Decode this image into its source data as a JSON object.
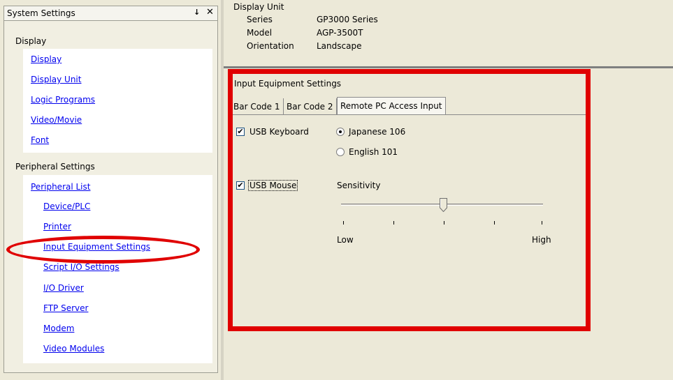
{
  "left_panel": {
    "title": "System Settings",
    "pin_icon": "↓",
    "close_icon": "✕",
    "groups": [
      {
        "heading": "Display",
        "items": [
          "Display",
          "Display Unit",
          "Logic Programs",
          "Video/Movie",
          "Font"
        ]
      },
      {
        "heading": "Peripheral Settings",
        "items": [
          "Peripheral List",
          "Device/PLC",
          "Printer",
          "Input Equipment Settings",
          "Script I/O Settings",
          "I/O Driver",
          "FTP Server",
          "Modem",
          "Video Modules"
        ]
      }
    ],
    "highlight_color": "#e00000"
  },
  "display_unit": {
    "heading": "Display Unit",
    "rows": [
      {
        "label": "Series",
        "value": "GP3000 Series"
      },
      {
        "label": "Model",
        "value": "AGP-3500T"
      },
      {
        "label": "Orientation",
        "value": "Landscape"
      }
    ]
  },
  "input_settings": {
    "title": "Input Equipment Settings",
    "tabs": [
      "Bar Code 1",
      "Bar Code 2",
      "Remote PC Access Input"
    ],
    "active_tab": "Remote PC Access Input",
    "usb_keyboard": {
      "label": "USB Keyboard",
      "checked": true,
      "options": [
        "Japanese 106",
        "English 101"
      ],
      "selected": "Japanese 106"
    },
    "usb_mouse": {
      "label": "USB Mouse",
      "checked": true,
      "sensitivity_label": "Sensitivity",
      "sensitivity_level": 0.5,
      "low_label": "Low",
      "high_label": "High"
    },
    "check_mark": "✔",
    "highlight_color": "#e00000"
  }
}
